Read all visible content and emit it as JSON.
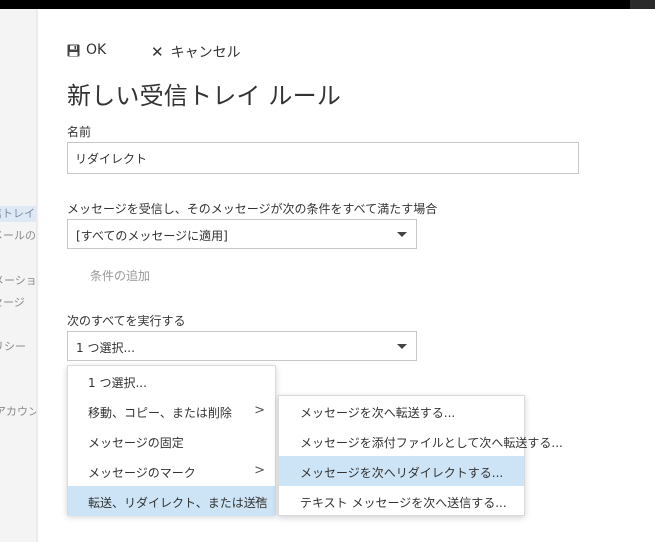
{
  "left_nav": {
    "items": [
      {
        "label": "受信トレイの処理ルール",
        "selected": true
      },
      {
        "label": "迷惑メールの報告"
      },
      {
        "label": "オートメーション"
      },
      {
        "label": "メッセージ"
      },
      {
        "label": "ポリシー"
      },
      {
        "label": "接続されたアカウント"
      }
    ]
  },
  "toolbar": {
    "ok_label": "OK",
    "cancel_label": "キャンセル"
  },
  "page": {
    "title": "新しい受信トレイ ルール"
  },
  "form": {
    "name_label": "名前",
    "name_value": "リダイレクト",
    "condition_label": "メッセージを受信し、そのメッセージが次の条件をすべて満たす場合",
    "condition_value": "[すべてのメッセージに適用]",
    "add_condition_label": "条件の追加",
    "action_label": "次のすべてを実行する",
    "action_value": "1 つ選択..."
  },
  "action_menu": {
    "items": [
      {
        "label": "1 つ選択...",
        "has_submenu": false,
        "highlighted": false
      },
      {
        "label": "移動、コピー、または削除",
        "has_submenu": true,
        "highlighted": false
      },
      {
        "label": "メッセージの固定",
        "has_submenu": false,
        "highlighted": false
      },
      {
        "label": "メッセージのマーク",
        "has_submenu": true,
        "highlighted": false
      },
      {
        "label": "転送、リダイレクト、または送信",
        "has_submenu": true,
        "highlighted": true
      }
    ]
  },
  "submenu": {
    "items": [
      {
        "label": "メッセージを次へ転送する...",
        "highlighted": false
      },
      {
        "label": "メッセージを添付ファイルとして次へ転送する...",
        "highlighted": false
      },
      {
        "label": "メッセージを次へリダイレクトする...",
        "highlighted": true
      },
      {
        "label": "テキスト メッセージを次へ送信する...",
        "highlighted": false
      }
    ]
  },
  "colors": {
    "highlight": "#cce4f6",
    "border": "#c8c8c8",
    "text": "#333333",
    "muted": "#9a9a9a"
  },
  "icons": {
    "ok": "save-icon",
    "cancel": "close-icon",
    "dropdown": "chevron-down-icon",
    "submenu": "chevron-right-icon"
  }
}
